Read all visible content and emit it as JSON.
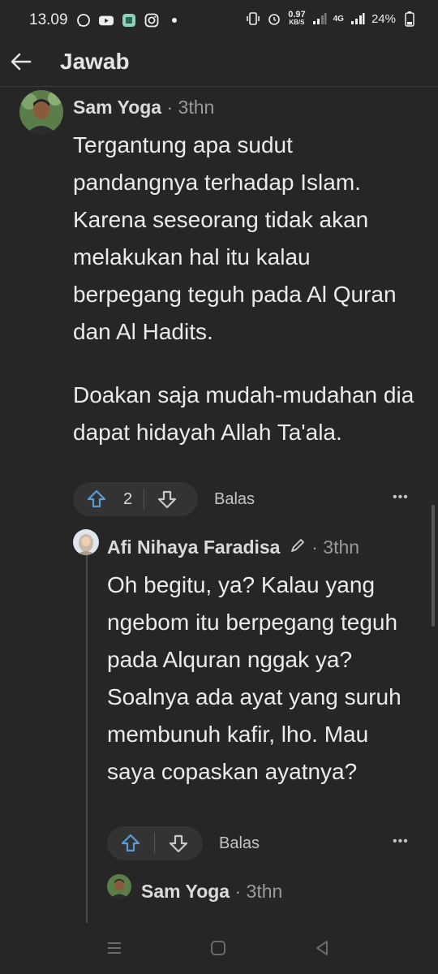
{
  "status_bar": {
    "time": "13.09",
    "data_rate": "0.97",
    "data_rate_unit": "KB/S",
    "network": "4G",
    "battery": "24%"
  },
  "header": {
    "title": "Jawab"
  },
  "comments": [
    {
      "author": "Sam Yoga",
      "meta": " · 3thn",
      "paragraphs": [
        "Tergantung apa sudut pandangnya terhadap Islam. Karena seseorang tidak akan melakukan hal itu kalau berpegang teguh pada Al Quran dan Al Hadits.",
        "Doakan saja mudah-mudahan dia dapat hidayah Allah Ta'ala."
      ],
      "upvotes": "2",
      "reply_label": "Balas",
      "more_label": "•••"
    },
    {
      "author": "Afi Nihaya Faradisa",
      "meta": " · 3thn",
      "paragraphs": [
        "Oh begitu, ya? Kalau yang ngebom itu berpegang teguh pada Alquran nggak ya? Soalnya ada ayat yang suruh membunuh kafir, lho. Mau saya copaskan ayatnya?"
      ],
      "reply_label": "Balas",
      "more_label": "•••"
    },
    {
      "author": "Sam Yoga",
      "meta": " · 3thn"
    }
  ],
  "colors": {
    "background": "#262626",
    "upvote_accent": "#5b9bd5",
    "text": "#ebebeb",
    "meta": "#9a9a9a"
  }
}
